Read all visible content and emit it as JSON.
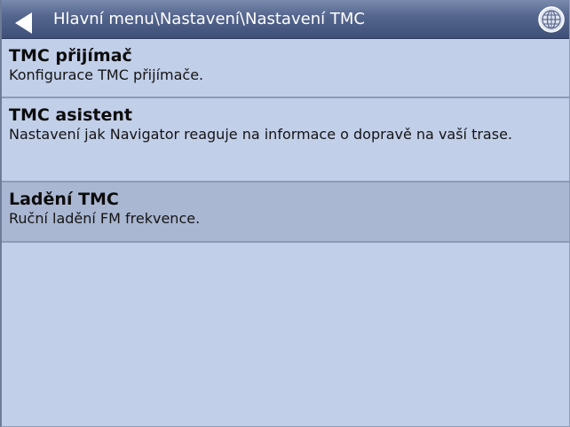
{
  "header": {
    "path": "Hlavní menu\\Nastavení\\Nastavení TMC",
    "back_icon": "back-arrow-icon",
    "globe_icon": "globe-icon"
  },
  "menu": {
    "items": [
      {
        "title": "TMC přijímač",
        "description": "Konfigurace TMC přijímače."
      },
      {
        "title": "TMC asistent",
        "description": "Nastavení jak Navigator reaguje na informace o dopravě na vaší trase."
      },
      {
        "title": "Ladění TMC",
        "description": "Ruční ladění FM frekvence.",
        "selected": true
      }
    ]
  },
  "colors": {
    "background": "#c2cfe9",
    "selected_background": "#aab7d2",
    "titlebar": "#56678f",
    "divider": "#8d9ab5"
  }
}
